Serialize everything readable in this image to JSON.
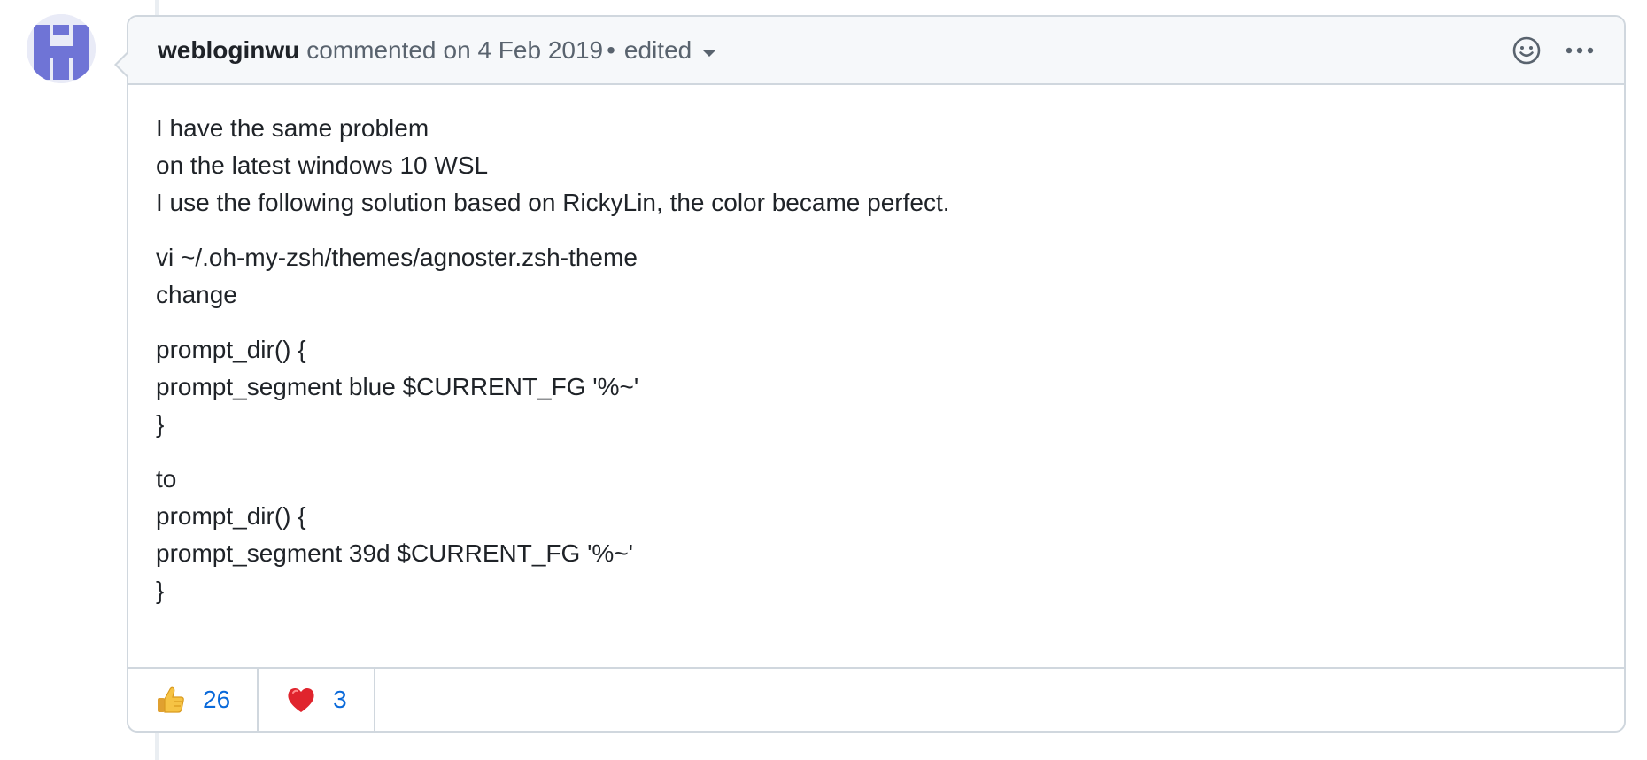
{
  "comment": {
    "author": "webloginwu",
    "action": "commented",
    "date": "on 4 Feb 2019",
    "separator": "•",
    "edited_label": "edited",
    "body_paragraphs": [
      [
        "I have the same problem",
        "on the latest windows 10 WSL",
        "I use the following solution based on RickyLin, the color became perfect."
      ],
      [
        "vi ~/.oh-my-zsh/themes/agnoster.zsh-theme",
        "change"
      ],
      [
        "prompt_dir() {",
        "prompt_segment blue $CURRENT_FG '%~'",
        "}"
      ],
      [
        "to",
        "prompt_dir() {",
        "prompt_segment 39d $CURRENT_FG '%~'",
        "}"
      ]
    ]
  },
  "header_icons": {
    "emoji": "smiley-icon",
    "more": "kebab-horizontal-icon"
  },
  "reactions": [
    {
      "icon": "thumbs-up-icon",
      "count": "26"
    },
    {
      "icon": "heart-icon",
      "count": "3"
    }
  ],
  "colors": {
    "link_blue": "#0969da",
    "border": "#d0d7de",
    "header_bg": "#f6f8fa",
    "avatar_purple": "#6f74d6"
  }
}
